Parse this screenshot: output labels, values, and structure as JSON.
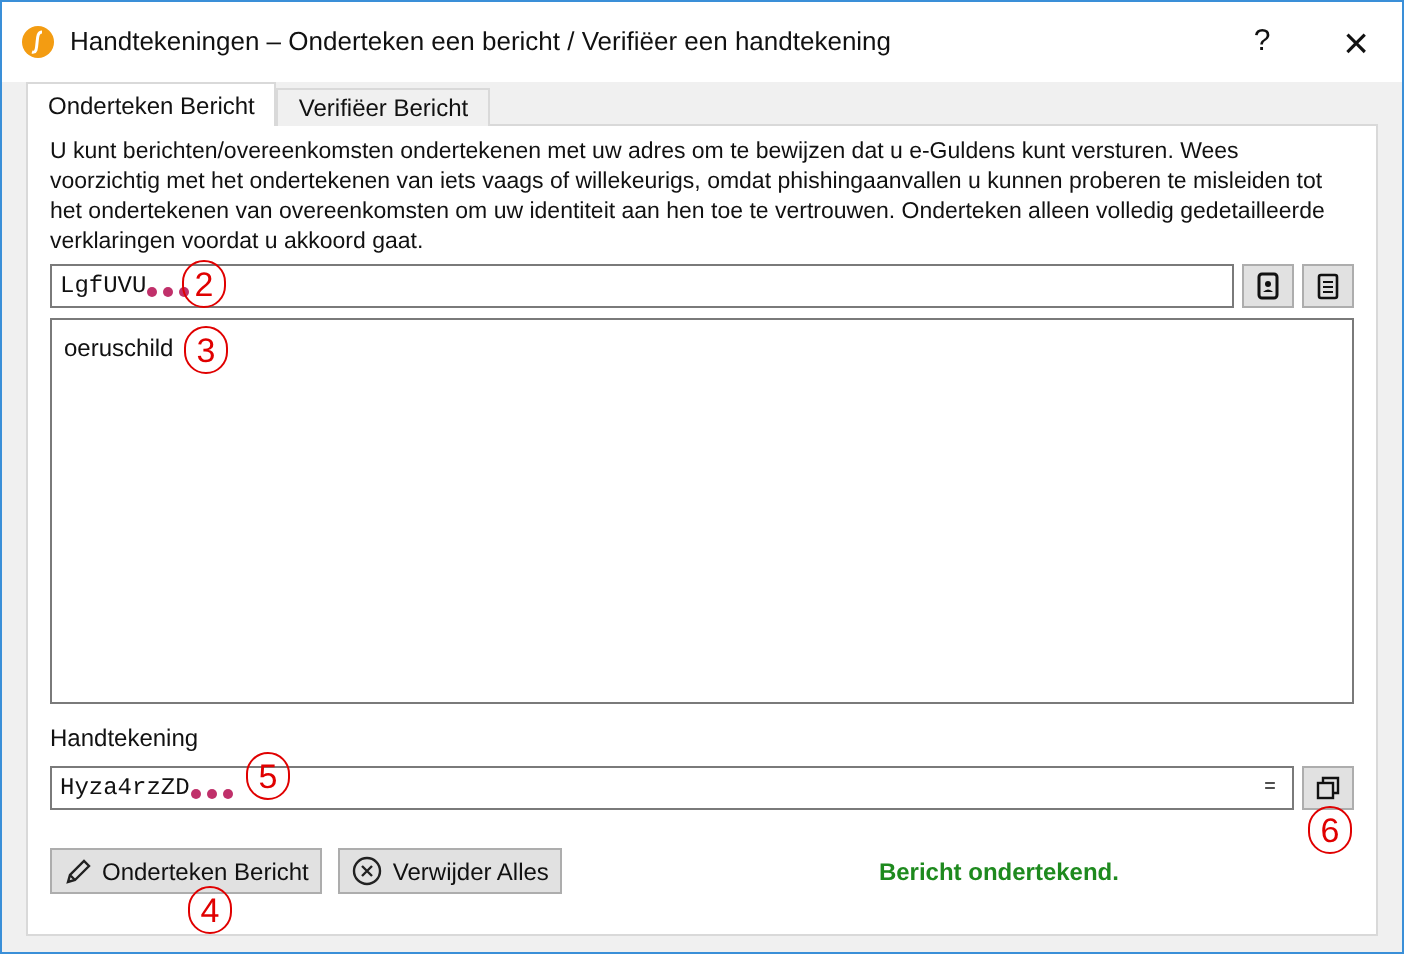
{
  "window": {
    "title": "Handtekeningen – Onderteken een bericht / Verifiëer een handtekening",
    "help": "?",
    "close": "×"
  },
  "tabs": [
    {
      "label": "Onderteken Bericht",
      "selected": true
    },
    {
      "label": "Verifiëer Bericht",
      "selected": false
    }
  ],
  "intro": "U kunt berichten/overeenkomsten ondertekenen met uw adres om te bewijzen dat u e-Guldens kunt versturen. Wees voorzichtig met het ondertekenen van iets vaags of willekeurigs, omdat phishingaanvallen u kunnen proberen te misleiden tot het ondertekenen van overeenkomsten om uw identiteit aan hen toe te vertrouwen. Onderteken alleen volledig gedetailleerde verklaringen voordat u akkoord gaat.",
  "address_field": {
    "value": "LgfUVU"
  },
  "message_field": {
    "value": "oeruschild"
  },
  "signature_label": "Handtekening",
  "signature_field": {
    "value": "Hyza4rzZD",
    "suffix": "="
  },
  "buttons": [
    {
      "label": "Onderteken Bericht",
      "kind": "pencil"
    },
    {
      "label": "Verwijder Alles",
      "kind": "clear"
    }
  ],
  "status": "Bericht ondertekend.",
  "callouts": [
    "2",
    "3",
    "4",
    "5",
    "6"
  ]
}
